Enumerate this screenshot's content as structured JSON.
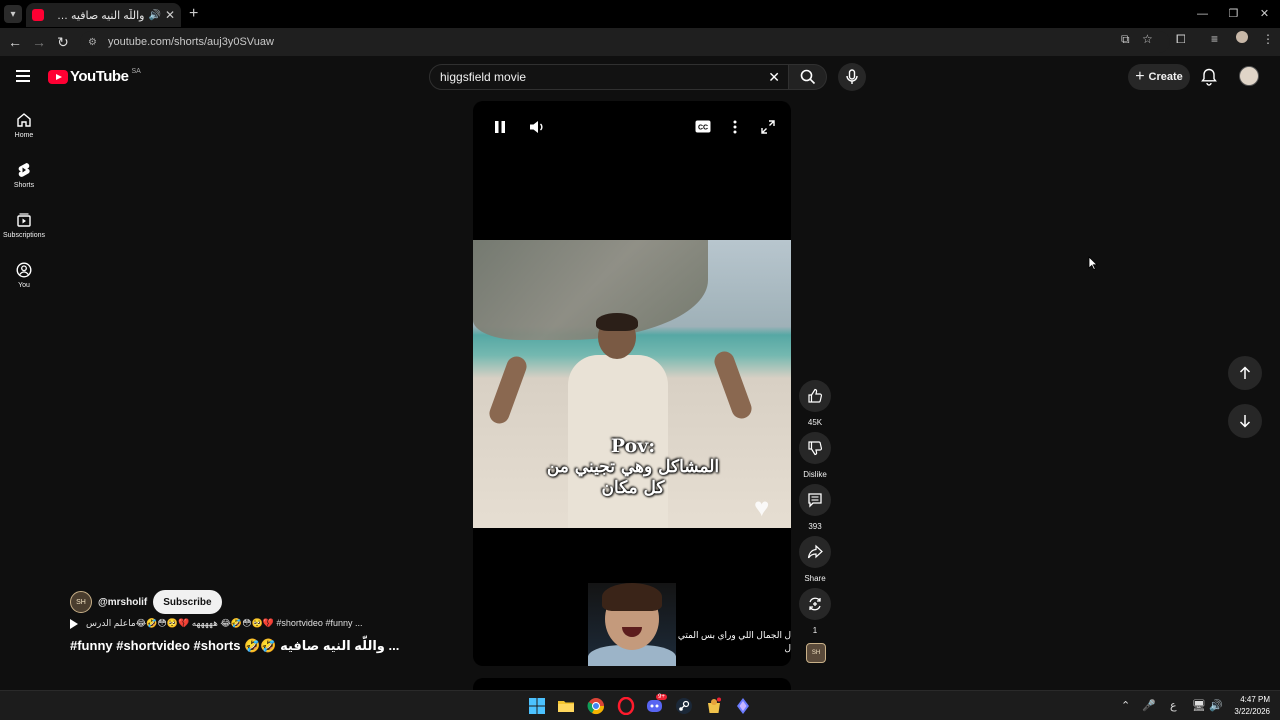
{
  "browser": {
    "tab_title": "واللّه النيه صافيه 🤣🤣 #funny",
    "url": "youtube.com/shorts/auj3y0SVuaw"
  },
  "header": {
    "logo_text": "YouTube",
    "country_code": "SA",
    "search_value": "higgsfield movie",
    "create_label": "Create"
  },
  "sidebar": {
    "items": [
      {
        "label": "Home",
        "icon": "home-icon"
      },
      {
        "label": "Shorts",
        "icon": "shorts-icon"
      },
      {
        "label": "Subscriptions",
        "icon": "subscriptions-icon"
      },
      {
        "label": "You",
        "icon": "you-icon"
      }
    ]
  },
  "player": {
    "caption_line1": "Pov:",
    "caption_line2": "المشاكل وهي تجيني من",
    "caption_line3": "كل مكان",
    "bottom_text_line1": "ل الجمال اللي وراي بس المتي",
    "bottom_text_line2": "ل"
  },
  "actions": {
    "like_count": "45K",
    "dislike_label": "Dislike",
    "comment_count": "393",
    "share_label": "Share",
    "remix_count": "1"
  },
  "video_info": {
    "channel_handle": "@mrsholif",
    "channel_avatar_text": "SH",
    "subscribe_label": "Subscribe",
    "description": "هههههه 💔🥺😳🤣😂ماعلم الدرس 😂🤣😳🥺💔 #shortvideo #funny ...",
    "title": "#funny #shortvideo #shorts 🤣🤣 واللّه النيه صافيه ..."
  },
  "taskbar": {
    "time": "4:47 PM",
    "date": "3/22/2026",
    "discord_badge": "9+",
    "ime_label": "ع"
  },
  "colors": {
    "accent": "#ff0033",
    "background": "#0f0f0f",
    "surface": "#272727"
  }
}
